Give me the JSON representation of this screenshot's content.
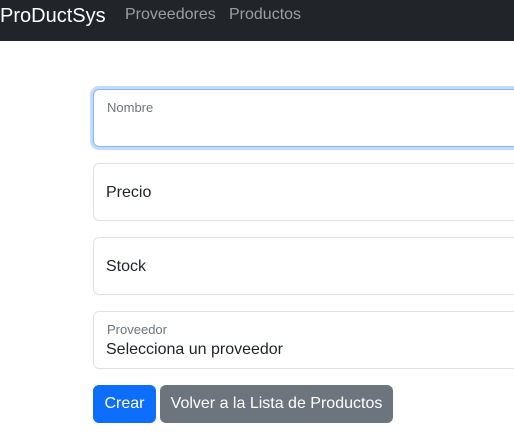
{
  "navbar": {
    "brand": "ProDuctSys",
    "links": [
      {
        "label": "Proveedores"
      },
      {
        "label": "Productos"
      }
    ]
  },
  "form": {
    "nombre": {
      "label": "Nombre",
      "value": ""
    },
    "precio": {
      "label": "Precio",
      "value": ""
    },
    "stock": {
      "label": "Stock",
      "value": ""
    },
    "proveedor": {
      "label": "Proveedor",
      "selected": "Selecciona un proveedor"
    }
  },
  "actions": {
    "create_label": "Crear",
    "back_label": "Volver a la Lista de Productos"
  },
  "colors": {
    "navbar_bg": "#212529",
    "primary": "#0d6efd",
    "secondary": "#6c757d",
    "focus_border": "#86b7fe"
  }
}
